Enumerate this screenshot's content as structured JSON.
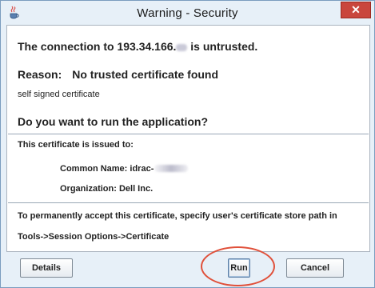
{
  "window": {
    "title": "Warning - Security",
    "close_label": "✕"
  },
  "message": {
    "headline_prefix": "The connection to 193.34.166.",
    "headline_suffix": " is untrusted.",
    "reason_label": "Reason:",
    "reason_text": "No trusted certificate found",
    "detail": "self signed certificate",
    "question": "Do you want to run the application?"
  },
  "certificate": {
    "issued_to_label": "This certificate is issued to:",
    "common_name_label": "Common Name:",
    "common_name_value": "idrac-",
    "organization_label": "Organization:",
    "organization_value": "Dell Inc."
  },
  "instructions": {
    "line1": "To permanently accept this certificate, specify user's certificate store path in",
    "line2": "Tools->Session Options->Certificate"
  },
  "buttons": {
    "details": "Details",
    "run": "Run",
    "cancel": "Cancel"
  },
  "colors": {
    "window_bg": "#e7f0f8",
    "close_button": "#c9463d",
    "highlight_ring": "#e0503a"
  },
  "icons": {
    "app": "java-cup-icon",
    "close": "close-icon"
  }
}
